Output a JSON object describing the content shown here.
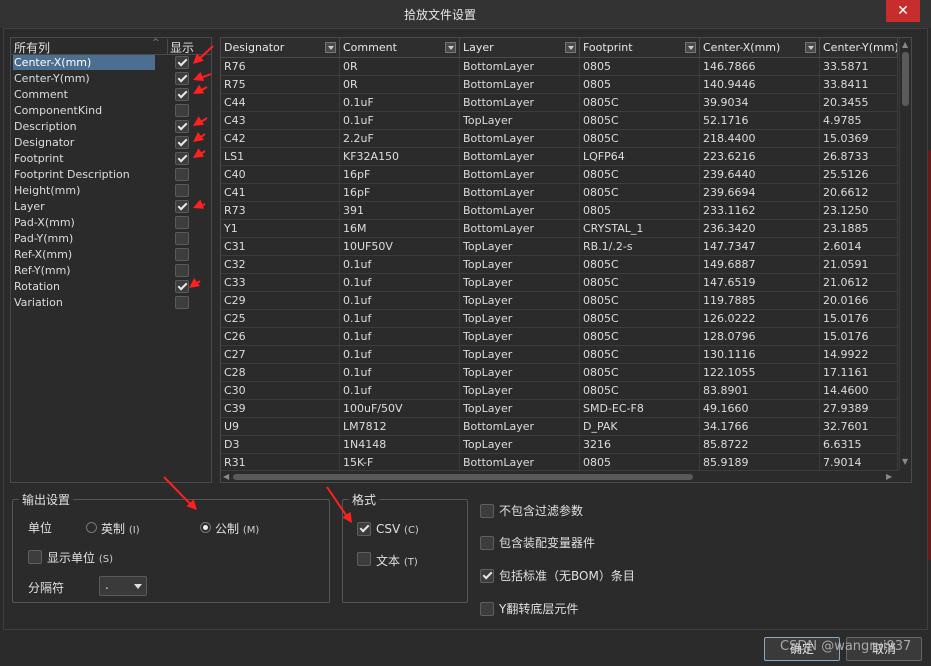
{
  "window": {
    "title": "拾放文件设置",
    "close_glyph": "✕"
  },
  "properties": {
    "header_all": "所有列",
    "header_show": "显示",
    "items": [
      {
        "label": "Center-X(mm)",
        "checked": true,
        "selected": true
      },
      {
        "label": "Center-Y(mm)",
        "checked": true
      },
      {
        "label": "Comment",
        "checked": true
      },
      {
        "label": "ComponentKind",
        "checked": false
      },
      {
        "label": "Description",
        "checked": true
      },
      {
        "label": "Designator",
        "checked": true
      },
      {
        "label": "Footprint",
        "checked": true
      },
      {
        "label": "Footprint Description",
        "checked": false
      },
      {
        "label": "Height(mm)",
        "checked": false
      },
      {
        "label": "Layer",
        "checked": true
      },
      {
        "label": "Pad-X(mm)",
        "checked": false
      },
      {
        "label": "Pad-Y(mm)",
        "checked": false
      },
      {
        "label": "Ref-X(mm)",
        "checked": false
      },
      {
        "label": "Ref-Y(mm)",
        "checked": false
      },
      {
        "label": "Rotation",
        "checked": true
      },
      {
        "label": "Variation",
        "checked": false
      }
    ]
  },
  "grid": {
    "columns": [
      "Designator",
      "Comment",
      "Layer",
      "Footprint",
      "Center-X(mm)",
      "Center-Y(mm)"
    ],
    "rows": [
      [
        "R76",
        "0R",
        "BottomLayer",
        "0805",
        "146.7866",
        "33.5871"
      ],
      [
        "R75",
        "0R",
        "BottomLayer",
        "0805",
        "140.9446",
        "33.8411"
      ],
      [
        "C44",
        "0.1uF",
        "BottomLayer",
        "0805C",
        "39.9034",
        "20.3455"
      ],
      [
        "C43",
        "0.1uF",
        "TopLayer",
        "0805C",
        "52.1716",
        "4.9785"
      ],
      [
        "C42",
        "2.2uF",
        "BottomLayer",
        "0805C",
        "218.4400",
        "15.0369"
      ],
      [
        "LS1",
        "KF32A150",
        "BottomLayer",
        "LQFP64",
        "223.6216",
        "26.8733"
      ],
      [
        "C40",
        "16pF",
        "BottomLayer",
        "0805C",
        "239.6440",
        "25.5126"
      ],
      [
        "C41",
        "16pF",
        "BottomLayer",
        "0805C",
        "239.6694",
        "20.6612"
      ],
      [
        "R73",
        "391",
        "BottomLayer",
        "0805",
        "233.1162",
        "23.1250"
      ],
      [
        "Y1",
        "16M",
        "BottomLayer",
        "CRYSTAL_1",
        "236.3420",
        "23.1885"
      ],
      [
        "C31",
        "10UF50V",
        "TopLayer",
        "RB.1/.2-s",
        "147.7347",
        "2.6014"
      ],
      [
        "C32",
        "0.1uf",
        "TopLayer",
        "0805C",
        "149.6887",
        "21.0591"
      ],
      [
        "C33",
        "0.1uf",
        "TopLayer",
        "0805C",
        "147.6519",
        "21.0612"
      ],
      [
        "C29",
        "0.1uf",
        "TopLayer",
        "0805C",
        "119.7885",
        "20.0166"
      ],
      [
        "C25",
        "0.1uf",
        "TopLayer",
        "0805C",
        "126.0222",
        "15.0176"
      ],
      [
        "C26",
        "0.1uf",
        "TopLayer",
        "0805C",
        "128.0796",
        "15.0176"
      ],
      [
        "C27",
        "0.1uf",
        "TopLayer",
        "0805C",
        "130.1116",
        "14.9922"
      ],
      [
        "C28",
        "0.1uf",
        "TopLayer",
        "0805C",
        "122.1055",
        "17.1161"
      ],
      [
        "C30",
        "0.1uf",
        "TopLayer",
        "0805C",
        "83.8901",
        "14.4600"
      ],
      [
        "C39",
        "100uF/50V",
        "TopLayer",
        "SMD-EC-F8",
        "49.1660",
        "27.9389"
      ],
      [
        "U9",
        "LM7812",
        "BottomLayer",
        "D_PAK",
        "34.1766",
        "32.7601"
      ],
      [
        "D3",
        "1N4148",
        "TopLayer",
        "3216",
        "85.8722",
        "6.6315"
      ],
      [
        "R31",
        "15K-F",
        "BottomLayer",
        "0805",
        "85.9189",
        "7.9014"
      ]
    ]
  },
  "output": {
    "legend": "输出设置",
    "unit_label": "单位",
    "imperial": "英制",
    "imperial_key": "(I)",
    "metric": "公制",
    "metric_key": "(M)",
    "unit_selected": "metric",
    "show_units": "显示单位",
    "show_units_key": "(S)",
    "show_units_checked": false,
    "separator_label": "分隔符",
    "separator_value": "."
  },
  "format": {
    "legend": "格式",
    "csv": "CSV",
    "csv_key": "(C)",
    "csv_checked": true,
    "text": "文本",
    "text_key": "(T)",
    "text_checked": false
  },
  "options": [
    {
      "label": "不包含过滤参数",
      "checked": false
    },
    {
      "label": "包含装配变量器件",
      "checked": false
    },
    {
      "label": "包括标准（无BOM）条目",
      "checked": true
    },
    {
      "label": "Y翻转底层元件",
      "checked": false
    }
  ],
  "buttons": {
    "ok": "确定",
    "cancel": "取消"
  },
  "watermark": "CSDN @wangrui937",
  "colors": {
    "selection": "#4c6f91",
    "annotation_arrow": "#ff2020",
    "close": "#c62e2e"
  }
}
